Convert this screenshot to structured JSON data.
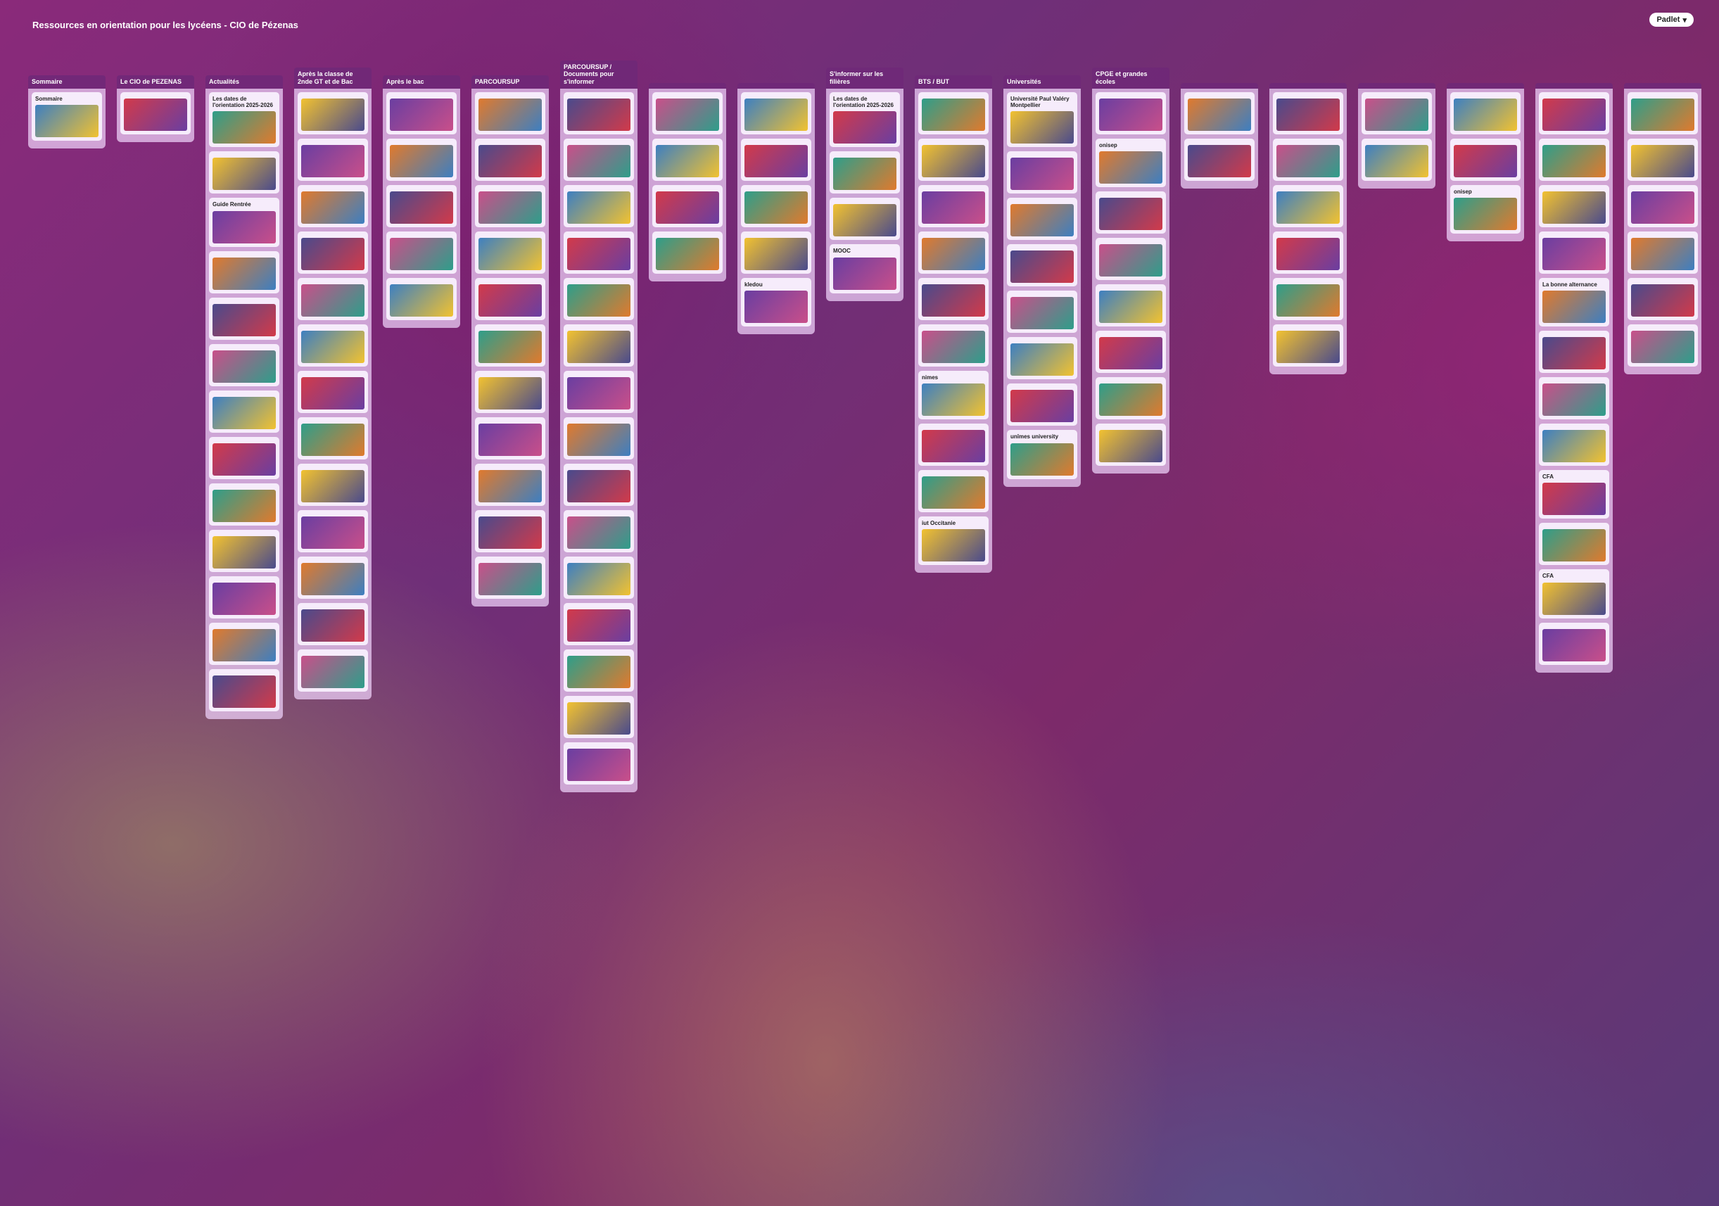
{
  "header": {
    "breadcrumb": "",
    "title": "Ressources en orientation pour les lycéens - CIO de Pézenas",
    "description": ""
  },
  "app": {
    "logo_label": "Padlet"
  },
  "columns": [
    {
      "title": "Sommaire",
      "cards": [
        "Sommaire"
      ]
    },
    {
      "title": "Le CIO de PEZENAS",
      "cards": [
        ""
      ]
    },
    {
      "title": "Actualités",
      "cards": [
        "Les dates de l'orientation 2025-2026",
        "",
        "Guide Rentrée",
        "",
        "",
        "",
        "",
        "",
        "",
        "",
        "",
        "",
        ""
      ]
    },
    {
      "title": "Après la classe de 2nde GT et de Bac",
      "cards": [
        "",
        "",
        "",
        "",
        "",
        "",
        "",
        "",
        "",
        "",
        "",
        "",
        ""
      ]
    },
    {
      "title": "Après le bac",
      "cards": [
        "",
        "",
        "",
        "",
        ""
      ]
    },
    {
      "title": "PARCOURSUP",
      "cards": [
        "",
        "",
        "",
        "",
        "",
        "",
        "",
        "",
        "",
        "",
        ""
      ]
    },
    {
      "title": "PARCOURSUP / Documents pour s'informer",
      "cards": [
        "",
        "",
        "",
        "",
        "",
        "",
        "",
        "",
        "",
        "",
        "",
        "",
        "",
        "",
        ""
      ]
    },
    {
      "title": "",
      "cards": [
        "",
        "",
        "",
        ""
      ]
    },
    {
      "title": "",
      "cards": [
        "",
        "",
        "",
        "",
        "kledou"
      ]
    },
    {
      "title": "S'informer sur les filières",
      "cards": [
        "Les dates de l'orientation 2025-2026",
        "",
        "",
        "MOOC"
      ]
    },
    {
      "title": "BTS / BUT",
      "cards": [
        "",
        "",
        "",
        "",
        "",
        "",
        "nimes",
        "",
        "",
        "iut Occitanie"
      ]
    },
    {
      "title": "Universités",
      "cards": [
        "Université Paul Valéry Montpellier",
        "",
        "",
        "",
        "",
        "",
        "",
        "unîmes university"
      ]
    },
    {
      "title": "CPGE et grandes écoles",
      "cards": [
        "",
        "onisep",
        "",
        "",
        "",
        "",
        "",
        ""
      ]
    },
    {
      "title": "",
      "cards": [
        "",
        ""
      ]
    },
    {
      "title": "",
      "cards": [
        "",
        "",
        "",
        "",
        "",
        ""
      ]
    },
    {
      "title": "",
      "cards": [
        "",
        ""
      ]
    },
    {
      "title": "",
      "cards": [
        "",
        "",
        "onisep"
      ]
    },
    {
      "title": "",
      "cards": [
        "",
        "",
        "",
        "",
        "La bonne alternance",
        "",
        "",
        "",
        "CFA",
        "",
        "CFA",
        ""
      ]
    },
    {
      "title": "",
      "cards": [
        "",
        "",
        "",
        "",
        "",
        ""
      ]
    }
  ],
  "colors": {
    "column_bg": "#ebcdf5",
    "header_bg": "#6e2878",
    "card_bg": "#f6ecfb",
    "onisep_red": "#e2001a",
    "iut_red": "#c8102e",
    "cfa_blue": "#1f4e9a"
  }
}
